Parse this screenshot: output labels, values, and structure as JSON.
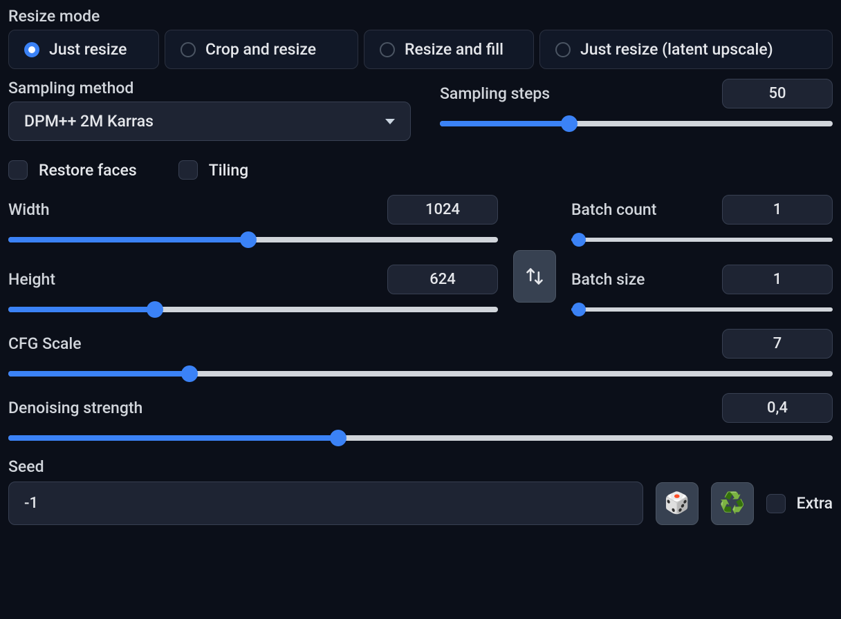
{
  "resize_mode": {
    "label": "Resize mode",
    "options": [
      {
        "label": "Just resize",
        "selected": true
      },
      {
        "label": "Crop and resize",
        "selected": false
      },
      {
        "label": "Resize and fill",
        "selected": false
      },
      {
        "label": "Just resize (latent upscale)",
        "selected": false
      }
    ]
  },
  "sampling_method": {
    "label": "Sampling method",
    "value": "DPM++ 2M Karras"
  },
  "sampling_steps": {
    "label": "Sampling steps",
    "value": "50",
    "fill_pct": 33
  },
  "restore_faces": {
    "label": "Restore faces",
    "checked": false
  },
  "tiling": {
    "label": "Tiling",
    "checked": false
  },
  "width": {
    "label": "Width",
    "value": "1024",
    "fill_pct": 49
  },
  "height": {
    "label": "Height",
    "value": "624",
    "fill_pct": 30
  },
  "batch_count": {
    "label": "Batch count",
    "value": "1",
    "fill_pct": 3
  },
  "batch_size": {
    "label": "Batch size",
    "value": "1",
    "fill_pct": 3
  },
  "cfg_scale": {
    "label": "CFG Scale",
    "value": "7",
    "fill_pct": 22
  },
  "denoising": {
    "label": "Denoising strength",
    "value": "0,4",
    "fill_pct": 40
  },
  "seed": {
    "label": "Seed",
    "value": "-1"
  },
  "extra": {
    "label": "Extra",
    "checked": false
  },
  "icons": {
    "dice": "🎲",
    "recycle": "♻️"
  }
}
